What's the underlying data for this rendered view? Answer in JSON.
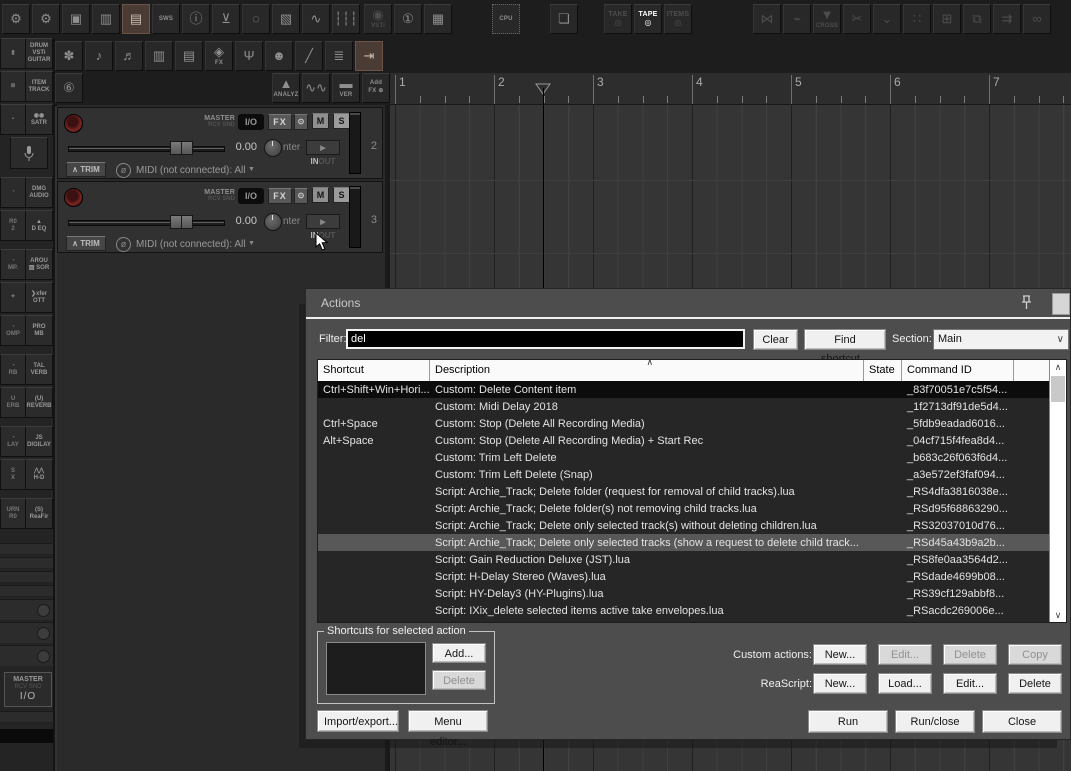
{
  "icons": {
    "up": "∧",
    "down": "∨",
    "dropdown": "∨",
    "midi_arrow": "▼",
    "in_tri": "▶",
    "phase": "ø",
    "trim_arrow": "∧"
  },
  "toolbar": {
    "row1": [
      [
        {
          "name": "render-settings",
          "glyph": "⚙"
        },
        {
          "name": "preferences-gears",
          "glyph": "⚙"
        },
        {
          "name": "save-project",
          "glyph": "▣"
        },
        {
          "name": "trash",
          "glyph": "▥"
        },
        {
          "name": "notes-book",
          "glyph": "▤",
          "active": true
        },
        {
          "name": "sws-extension",
          "label": "SWS"
        },
        {
          "name": "info-circle",
          "glyph": "ⓘ"
        },
        {
          "name": "shirt",
          "glyph": "⊻"
        },
        {
          "name": "magnifier",
          "glyph": "◌"
        },
        {
          "name": "marquee-select",
          "glyph": "▧"
        },
        {
          "name": "waveform-view",
          "glyph": "∿"
        },
        {
          "name": "mixer-faders",
          "glyph": "┆┆┆"
        }
      ],
      [
        {
          "name": "vsti-view",
          "label": "VSTi",
          "glyph": "◉",
          "dim": true
        },
        {
          "name": "plugin-info",
          "glyph": "①"
        },
        {
          "name": "grid-table",
          "glyph": "▦"
        }
      ],
      [
        {
          "name": "cpu-meter",
          "label": "CPU",
          "chip": true
        }
      ],
      [
        {
          "name": "quantize-grid",
          "glyph": "❏"
        }
      ],
      [
        {
          "name": "take-mode",
          "label": "TAKE",
          "sub": "◎",
          "dim": true,
          "tape": true
        },
        {
          "name": "tape-mode",
          "label": "TAPE",
          "sub": "◎",
          "bright": true,
          "tape": true
        },
        {
          "name": "items-mode",
          "label": "ITEMS",
          "sub": "◎",
          "dim": true,
          "tape": true
        }
      ],
      [
        {
          "name": "crossfade",
          "glyph": "⋈",
          "dim": true
        },
        {
          "name": "envelope-points",
          "glyph": "⌁",
          "dim": true
        },
        {
          "name": "crossfade-cross",
          "glyph": "▼",
          "label": "CROSS",
          "dim": true
        },
        {
          "name": "cut-items",
          "glyph": "✂",
          "dim": true
        },
        {
          "name": "split-item",
          "glyph": "⌄",
          "dim": true
        },
        {
          "name": "grid-dots",
          "glyph": "∷",
          "dim": true
        },
        {
          "name": "item-edges",
          "glyph": "⊞",
          "dim": true
        },
        {
          "name": "duplicate-items",
          "glyph": "⧉",
          "dim": true
        },
        {
          "name": "items-arrow",
          "glyph": "⇉",
          "dim": true
        },
        {
          "name": "glue-link",
          "glyph": "∞",
          "dim": true
        }
      ]
    ],
    "row2": [
      [
        {
          "name": "drums",
          "glyph": "✽"
        },
        {
          "name": "bass-clef",
          "glyph": "♪"
        },
        {
          "name": "guitar",
          "glyph": "♬"
        },
        {
          "name": "piano-keys",
          "glyph": "▥"
        },
        {
          "name": "midi-keyboard",
          "glyph": "▤"
        },
        {
          "name": "fx-box",
          "label": "FX",
          "glyph": "◈"
        },
        {
          "name": "microphone",
          "glyph": "Ψ"
        },
        {
          "name": "person",
          "glyph": "☻"
        },
        {
          "name": "cable-jack",
          "glyph": "╱"
        },
        {
          "name": "monitor-levels",
          "glyph": "≣"
        },
        {
          "name": "render-arrow",
          "glyph": "⇥",
          "active": true
        }
      ]
    ],
    "row3_left": {
      "name": "circled-six",
      "glyph": "⑥"
    },
    "row3_right": [
      {
        "name": "analyzer",
        "glyph": "▲",
        "label": "ANALYZ"
      },
      {
        "name": "worm-wave",
        "glyph": "∿∿"
      },
      {
        "name": "version",
        "label": "VER",
        "glyph": "▬"
      },
      {
        "name": "add-fx",
        "label2": [
          "Add",
          "FX ⊕"
        ]
      }
    ]
  },
  "sidebar": {
    "items": [
      {
        "frag": "▮",
        "label": [
          "DRUM",
          "VSTi",
          "GUITAR"
        ]
      },
      {
        "frag": "≣",
        "label": [
          "ITEM",
          "TRACK"
        ]
      },
      {
        "frag": "▪",
        "label": [
          "◉◉",
          "SATR"
        ]
      },
      {
        "mic": true
      },
      {
        "frag": "◔",
        "label": [
          "DMG",
          "AUDIO"
        ],
        "gap": true
      },
      {
        "frag": "R0 2",
        "label": [
          "▲",
          "D EQ"
        ]
      },
      {
        "frag": "◔ MP.",
        "label": [
          "AROU",
          "▨ SOR"
        ],
        "gap": true
      },
      {
        "frag": "✦",
        "label": [
          "❯xfer",
          "OTT"
        ]
      },
      {
        "frag": "◔ OMP",
        "label": [
          "PRO",
          "MB"
        ]
      },
      {
        "frag": "◔ RB",
        "label": [
          "TAL",
          "VERB"
        ],
        "gap": true
      },
      {
        "frag": "U ERB",
        "label": [
          "(U)",
          "REVERB"
        ]
      },
      {
        "frag": "◔ LAY",
        "label": [
          "JS",
          "DIGILAY"
        ],
        "gap": true
      },
      {
        "frag": "S X",
        "label": [
          "⋀⋀",
          "H-D"
        ]
      },
      {
        "frag": "URN R0",
        "label": [
          "(S)",
          "ReaFir"
        ],
        "gap": true
      }
    ]
  },
  "master": {
    "title": "MASTER",
    "sub": "RCV SND",
    "io": "I/O"
  },
  "ruler": {
    "marks": [
      "1",
      "2",
      "3",
      "4",
      "5",
      "6",
      "7"
    ]
  },
  "tracks": {
    "labels": {
      "master": "MASTER",
      "rcvsnd": "RCV SND",
      "io": "I/O",
      "fx": "FX",
      "power": "⊙",
      "mute": "M",
      "solo": "S",
      "volume": "0.00",
      "pan": "nter",
      "in": "IN",
      "out": "OUT",
      "trim": "TRIM",
      "midi": "MIDI (not connected): All"
    },
    "items": [
      {
        "number": "2"
      },
      {
        "number": "3"
      }
    ]
  },
  "dialog": {
    "title": "Actions",
    "filter_label": "Filter:",
    "filter_value": "del",
    "clear_label": "Clear",
    "find_label": "Find shortcut...",
    "section_label": "Section:",
    "section_value": "Main",
    "sort_indicator": "∧",
    "columns": [
      "Shortcut",
      "Description",
      "State",
      "Command ID"
    ],
    "rows": [
      {
        "shortcut": "Ctrl+Shift+Win+Hori...",
        "description": "Custom: Delete Content item",
        "state": "",
        "command_id": "_83f70051e7c5f54...",
        "dark": true
      },
      {
        "shortcut": "",
        "description": "Custom: Midi Delay 2018",
        "state": "",
        "command_id": "_1f2713df91de5d4..."
      },
      {
        "shortcut": "Ctrl+Space",
        "description": "Custom: Stop (Delete All Recording Media)",
        "state": "",
        "command_id": "_5fdb9eadad6016..."
      },
      {
        "shortcut": "Alt+Space",
        "description": "Custom: Stop (Delete All Recording Media) + Start Rec",
        "state": "",
        "command_id": "_04cf715f4fea8d4..."
      },
      {
        "shortcut": "",
        "description": "Custom: Trim Left Delete",
        "state": "",
        "command_id": "_b683c26f063f6d4..."
      },
      {
        "shortcut": "",
        "description": "Custom: Trim Left Delete (Snap)",
        "state": "",
        "command_id": "_a3e572ef3faf094..."
      },
      {
        "shortcut": "",
        "description": "Script: Archie_Track;  Delete folder (request for removal of child tracks).lua",
        "state": "",
        "command_id": "_RS4dfa3816038e..."
      },
      {
        "shortcut": "",
        "description": "Script: Archie_Track;  Delete folder(s) not removing child tracks.lua",
        "state": "",
        "command_id": "_RSd95f68863290..."
      },
      {
        "shortcut": "",
        "description": "Script: Archie_Track;  Delete only selected track(s) without deleting children.lua",
        "state": "",
        "command_id": "_RS32037010d76..."
      },
      {
        "shortcut": "",
        "description": "Script: Archie_Track;  Delete only selected tracks (show a request to delete child track...",
        "state": "",
        "command_id": "_RSd45a43b9a2b...",
        "selected": true
      },
      {
        "shortcut": "",
        "description": "Script: Gain Reduction Deluxe (JST).lua",
        "state": "",
        "command_id": "_RS8fe0aa3564d2..."
      },
      {
        "shortcut": "",
        "description": "Script: H-Delay Stereo (Waves).lua",
        "state": "",
        "command_id": "_RSdade4699b08..."
      },
      {
        "shortcut": "",
        "description": "Script: HY-Delay3 (HY-Plugins).lua",
        "state": "",
        "command_id": "_RS39cf129abbf8..."
      },
      {
        "shortcut": "",
        "description": "Script: IXix_delete selected items active take envelopes.lua",
        "state": "",
        "command_id": "_RSacdc269006e..."
      }
    ],
    "shortcuts_group_label": "Shortcuts for selected action",
    "add_label": "Add...",
    "delete_label": "Delete",
    "custom_actions_label": "Custom actions:",
    "custom_actions_buttons": [
      {
        "label": "New...",
        "disabled": false
      },
      {
        "label": "Edit...",
        "disabled": true
      },
      {
        "label": "Delete",
        "disabled": true
      },
      {
        "label": "Copy",
        "disabled": true
      }
    ],
    "reascript_label": "ReaScript:",
    "reascript_buttons": [
      {
        "label": "New...",
        "disabled": false
      },
      {
        "label": "Load...",
        "disabled": false
      },
      {
        "label": "Edit...",
        "disabled": false
      },
      {
        "label": "Delete",
        "disabled": false
      }
    ],
    "import_export_label": "Import/export...",
    "menu_editor_label": "Menu editor...",
    "bottom_buttons": [
      {
        "label": "Run"
      },
      {
        "label": "Run/close"
      },
      {
        "label": "Close"
      }
    ]
  }
}
